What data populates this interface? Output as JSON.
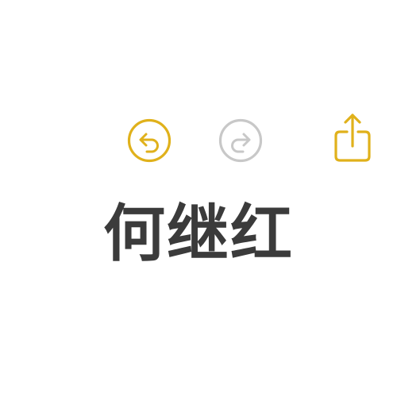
{
  "toolbar": {
    "undo": {
      "icon": "undo-icon",
      "enabled": true,
      "color": "#E0B11B"
    },
    "redo": {
      "icon": "redo-icon",
      "enabled": false,
      "color": "#C8C8C8"
    },
    "share": {
      "icon": "share-icon",
      "enabled": true,
      "color": "#E0B11B"
    }
  },
  "document": {
    "title": "何继红",
    "text_color": "#3B3B3B"
  }
}
